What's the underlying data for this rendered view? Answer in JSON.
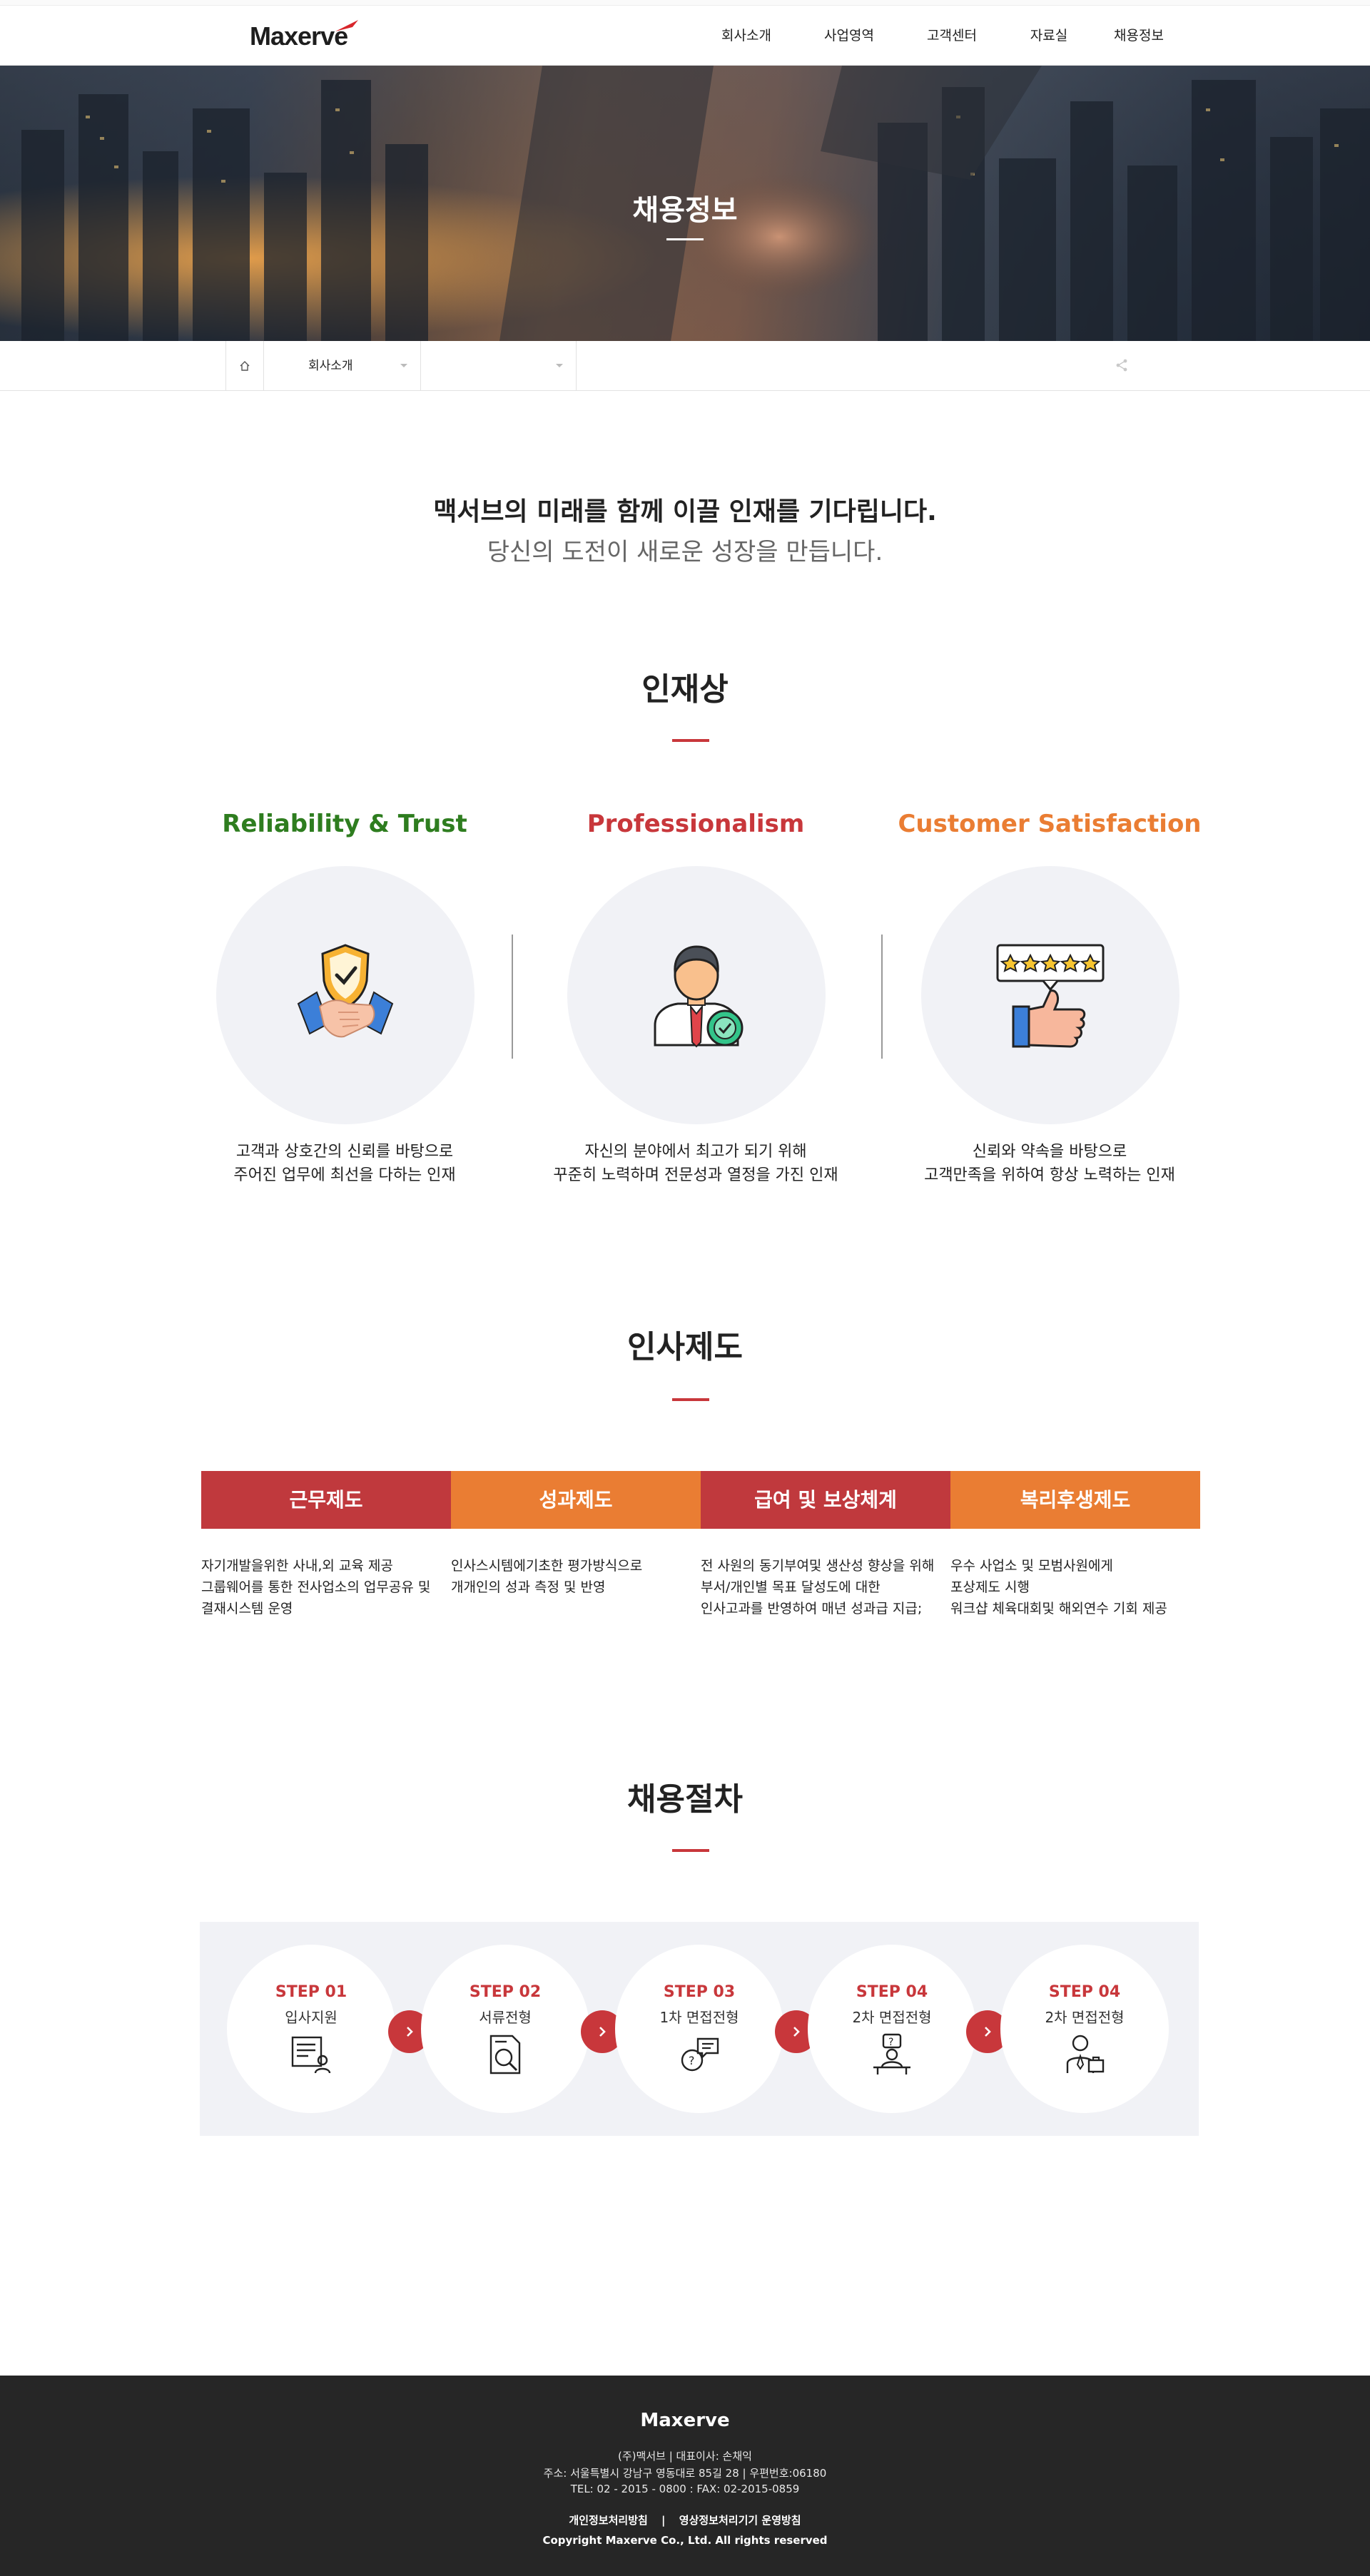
{
  "header": {
    "logo": "Maxerve",
    "nav": [
      "회사소개",
      "사업영역",
      "고객센터",
      "자료실",
      "채용정보"
    ]
  },
  "hero": {
    "title": "채용정보"
  },
  "subnav": {
    "first": "회사소개",
    "second": ""
  },
  "intro": {
    "line1": "맥서브의 미래를 함께 이끌 인재를 기다립니다.",
    "line2": "당신의 도전이 새로운 성장을 만듭니다."
  },
  "talent": {
    "title": "인재상",
    "items": [
      {
        "heading": "Reliability & Trust",
        "color": "#2e7d1f",
        "desc1": "고객과 상호간의 신뢰를 바탕으로",
        "desc2": "주어진 업무에 최선을 다하는 인재",
        "icon": "handshake-shield-icon"
      },
      {
        "heading": "Professionalism",
        "color": "#c8373b",
        "desc1": "자신의 분야에서 최고가 되기 위해",
        "desc2": "꾸준히 노력하며 전문성과 열정을 가진 인재",
        "icon": "professional-person-icon"
      },
      {
        "heading": "Customer Satisfaction",
        "color": "#ea7d33",
        "desc1": "신뢰와 약속을 바탕으로",
        "desc2": "고객만족을 위하여 항상 노력하는 인재",
        "icon": "thumbs-up-rating-icon"
      }
    ]
  },
  "hr": {
    "title": "인사제도",
    "items": [
      {
        "heading": "근무제도",
        "color": "#c0393d",
        "lines": [
          "자기개발을위한 사내,외 교육 제공",
          "그룹웨어를 통한 전사업소의 업무공유 및",
          "결재시스템 운영"
        ]
      },
      {
        "heading": "성과제도",
        "color": "#ea7d33",
        "lines": [
          "인사스시템에기초한 평가방식으로",
          "개개인의 성과 측정 및 반영"
        ]
      },
      {
        "heading": "급여 및 보상체계",
        "color": "#c0393d",
        "lines": [
          "전 사원의 동기부여및 생산성 향상을 위해",
          "부서/개인별 목표 달성도에 대한",
          "인사고과를 반영하여 매년 성과급 지급;"
        ]
      },
      {
        "heading": "복리후생제도",
        "color": "#ea7d33",
        "lines": [
          "우수 사업소 및 모범사원에게",
          "포상제도 시행",
          "워크샵 체육대회및 해외연수 기회 제공"
        ]
      }
    ]
  },
  "process": {
    "title": "채용절차",
    "steps": [
      {
        "num": "STEP 01",
        "label": "입사지원",
        "icon": "application-form-icon"
      },
      {
        "num": "STEP 02",
        "label": "서류전형",
        "icon": "document-review-icon"
      },
      {
        "num": "STEP 03",
        "label": "1차 면접전형",
        "icon": "interview-chat-icon"
      },
      {
        "num": "STEP 04",
        "label": "2차 면접전형",
        "icon": "interviewer-desk-icon"
      },
      {
        "num": "STEP 04",
        "label": "2차 면접전형",
        "icon": "hired-person-icon"
      }
    ]
  },
  "footer": {
    "brand": "Maxerve",
    "line1": "(주)맥서브 | 대표이사: 손채익",
    "line2": "주소: 서울특별시 강남구 영동대로 85길 28 | 우편번호:06180",
    "line3": "TEL: 02 - 2015 - 0800 : FAX: 02-2015-0859",
    "link1": "개인정보처리방침",
    "link2": "영상정보처리기기 운영방침",
    "copyright": "Copyright  Maxerve Co., Ltd. All rights reserved"
  },
  "colors": {
    "accent_red": "#c8373b",
    "accent_orange": "#ea7d33",
    "accent_green": "#2e7d1f",
    "footer_bg": "#262626"
  }
}
